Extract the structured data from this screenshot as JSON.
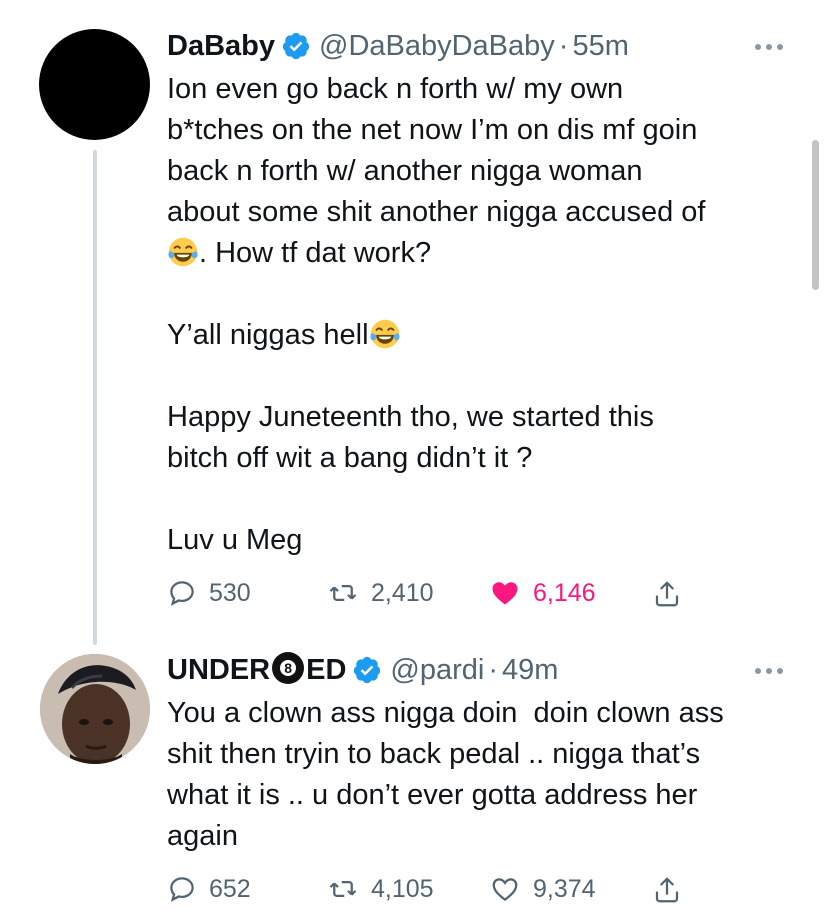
{
  "tweets": [
    {
      "name": "DaBaby",
      "handle": "@DaBabyDaBaby",
      "dot": "·",
      "time": "55m",
      "text_1": "Ion even go back n forth w/ my own\nb*tches on the net now I’m on dis mf goin\nback n forth w/ another nigga woman\nabout some shit another nigga accused of\n",
      "text_2": ". How tf dat work?",
      "text_3": "Y’all niggas hell",
      "text_4": "Happy Juneteenth tho, we started this\nbitch off wit a bang didn’t it ?",
      "text_5": "Luv u Meg",
      "replies": "530",
      "retweets": "2,410",
      "likes": "6,146",
      "liked": true
    },
    {
      "name_before": "UNDER",
      "name_mid": "8",
      "name_after": "ED",
      "handle": "@pardi",
      "dot": "·",
      "time": "49m",
      "text": "You a clown ass nigga doin  doin clown ass\nshit then tryin to back pedal .. nigga that’s\nwhat it is .. u don’t ever gotta address her\nagain",
      "replies": "652",
      "retweets": "4,105",
      "likes": "9,374",
      "liked": false
    }
  ],
  "colors": {
    "text": "#0f1419",
    "secondary": "#536471",
    "verified": "#1d9bf0",
    "like": "#f91880",
    "thread_line": "#cfd9de"
  },
  "icons": {
    "verified": "verified-badge-icon",
    "more": "more-options-icon",
    "reply": "reply-icon",
    "retweet": "retweet-icon",
    "like": "heart-icon",
    "share": "share-icon",
    "emoji": "laughing-tears-emoji"
  }
}
